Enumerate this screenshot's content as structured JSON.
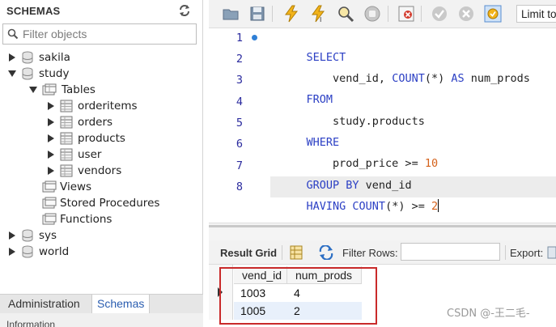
{
  "navigator": {
    "title": "SCHEMAS",
    "filter_placeholder": "Filter objects",
    "tree": {
      "sakila": "sakila",
      "study": "study",
      "tables": "Tables",
      "tables_list": [
        "orderitems",
        "orders",
        "products",
        "user",
        "vendors"
      ],
      "views": "Views",
      "stored_procedures": "Stored Procedures",
      "functions": "Functions",
      "sys": "sys",
      "world": "world"
    },
    "tabs": {
      "administration": "Administration",
      "schemas": "Schemas"
    },
    "info_label": "Information"
  },
  "toolbar": {
    "limit_label": "Limit to"
  },
  "editor": {
    "line_numbers": [
      "1",
      "2",
      "3",
      "4",
      "5",
      "6",
      "7",
      "8"
    ],
    "lines": {
      "l1_kw": "SELECT",
      "l2_id1": "vend_id, ",
      "l2_fn": "COUNT",
      "l2_rest": "(*) ",
      "l2_as": "AS",
      "l2_alias": " num_prods",
      "l3_kw": "FROM",
      "l4_id": "study.products",
      "l5_kw": "WHERE",
      "l6_id": "prod_price >= ",
      "l6_num": "10",
      "l7_kw": "GROUP BY",
      "l7_id": " vend_id",
      "l8_kw": "HAVING",
      "l8_fn": " COUNT",
      "l8_rest": "(*) >= ",
      "l8_num": "2"
    }
  },
  "results": {
    "tab_label": "Result Grid",
    "filter_rows_label": "Filter Rows:",
    "export_label": "Export:",
    "columns": [
      "vend_id",
      "num_prods"
    ],
    "rows": [
      [
        "1003",
        "4"
      ],
      [
        "1005",
        "2"
      ]
    ]
  },
  "watermark": "CSDN @-王二毛-",
  "colors": {
    "keyword": "#2b3fc4",
    "number": "#d4621c",
    "highlight_box": "#c92a2a",
    "selected_tab": "#2a5db0"
  }
}
